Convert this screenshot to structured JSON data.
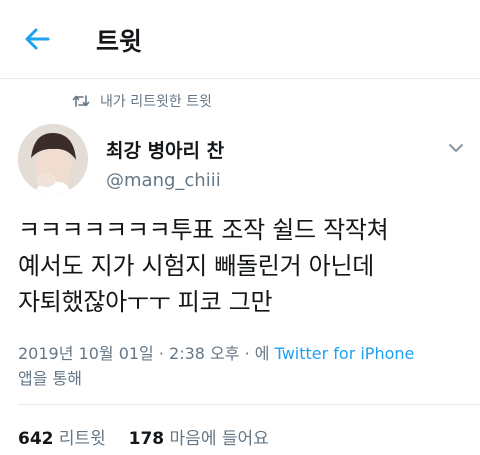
{
  "header": {
    "title": "트윗"
  },
  "retweet": {
    "label": "내가 리트윗한 트윗"
  },
  "author": {
    "name": "최강 병아리 찬",
    "handle": "@mang_chiii"
  },
  "tweet": {
    "text": "ㅋㅋㅋㅋㅋㅋㅋ투표 조작 쉴드 작작쳐\n예서도 지가 시험지 빼돌린거 아닌데\n자퇴했잖아ㅜㅜ 피코 그만"
  },
  "meta": {
    "date": "2019년 10월 01일 · 2:38 오후 · 에",
    "source": "Twitter for iPhone",
    "source_suffix": "앱을 통해"
  },
  "stats": {
    "retweets_count": "642",
    "retweets_label": "리트윗",
    "likes_count": "178",
    "likes_label": "마음에 들어요"
  },
  "colors": {
    "accent": "#1da1f2",
    "muted": "#657786",
    "text": "#14171a"
  },
  "icons": {
    "back": "arrow-left-icon",
    "retweet": "retweet-icon",
    "more": "chevron-down-icon"
  }
}
